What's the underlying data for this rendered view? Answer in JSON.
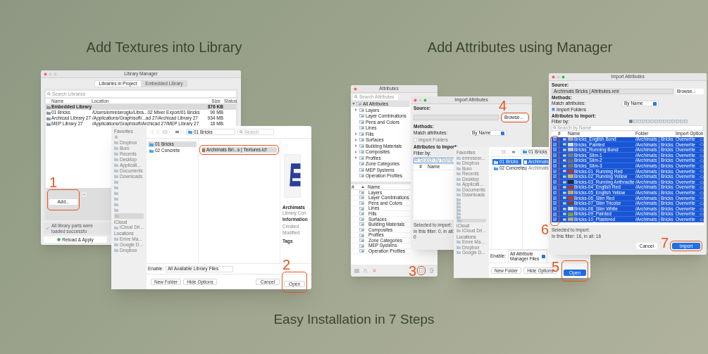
{
  "headings": {
    "left": "Add Textures into Library",
    "right": "Add Attributes using Manager",
    "footer": "Easy Installation in 7 Steps"
  },
  "library_manager": {
    "title": "Library Manager",
    "tabs": [
      {
        "label": "Libraries in Project",
        "selected": true
      },
      {
        "label": "Embedded Library",
        "selected": false
      }
    ],
    "search_placeholder": "Search Libraries",
    "columns": [
      "Name",
      "Location",
      "Size",
      "Status"
    ],
    "rows": [
      {
        "name": "Embedded Library",
        "location": "",
        "size": "876 KB",
        "selected": true
      },
      {
        "name": "01 Bricks",
        "location": "/Users/emreseroglu/Libra...02 Mixer Export/01 Bricks",
        "size": "90 MB",
        "selected": false
      },
      {
        "name": "Archicad Library 27",
        "location": "/Applications/Graphisoft/...ad 27/Archicad Library 27",
        "size": "934 MB",
        "selected": false
      },
      {
        "name": "MEP Library 27",
        "location": "/Applications/Graphisoft/Archicad 27/MEP Library 27",
        "size": "16 MB",
        "selected": false
      }
    ],
    "add_button": "Add...",
    "status_message": "All library parts were loaded successfu",
    "reload_button": "Reload & Apply"
  },
  "open_dialog_textures": {
    "sidebar": [
      {
        "kind": "header",
        "label": "Favorites"
      },
      {
        "kind": "home"
      },
      {
        "kind": "item",
        "label": "Dropbox"
      },
      {
        "kind": "item",
        "label": "Buro"
      },
      {
        "kind": "item",
        "label": "Recents"
      },
      {
        "kind": "item",
        "label": "Desktop"
      },
      {
        "kind": "item",
        "label": "Applicati..."
      },
      {
        "kind": "item",
        "label": "Documents"
      },
      {
        "kind": "item",
        "label": "Downloads"
      },
      {
        "kind": "folder"
      },
      {
        "kind": "folder"
      },
      {
        "kind": "folder"
      },
      {
        "kind": "folder"
      },
      {
        "kind": "folder"
      },
      {
        "kind": "folder"
      },
      {
        "kind": "selected"
      },
      {
        "kind": "header",
        "label": "iCloud"
      },
      {
        "kind": "item",
        "label": "iCloud Dri..."
      },
      {
        "kind": "header",
        "label": "Locations"
      },
      {
        "kind": "item",
        "label": "Emre Ma..."
      },
      {
        "kind": "item",
        "label": "Google D..."
      },
      {
        "kind": "item",
        "label": "Dropbox"
      }
    ],
    "path": "01 Bricks",
    "search_placeholder": "Search",
    "folders": [
      {
        "label": "01 Bricks",
        "selected": true
      },
      {
        "label": "02 Concrete",
        "selected": false
      }
    ],
    "files": [
      {
        "label": "Archimats Bri...s | Textures.lcf",
        "selected": true
      }
    ],
    "preview": {
      "title": "Archimats",
      "subtitle": "Library Con",
      "info": "Information",
      "fields": [
        "Created",
        "Modified"
      ],
      "tags": "Tags"
    },
    "enable_label": "Enable:",
    "enable_value": "All Available Library Files",
    "buttons": [
      {
        "label": "New Folder",
        "kind": "plain"
      },
      {
        "label": "Hide Options",
        "kind": "plain"
      },
      {
        "label": "Cancel",
        "kind": "right"
      },
      {
        "label": "Open",
        "kind": "right"
      }
    ]
  },
  "attributes_panel": {
    "title": "Attributes",
    "search_placeholder": "Search Attributes",
    "root": "All Attributes",
    "tree": [
      {
        "label": "Layers",
        "expandable": true
      },
      {
        "label": "Layer Combinations",
        "expandable": false
      },
      {
        "label": "Pens and Colors",
        "expandable": false
      },
      {
        "label": "Lines",
        "expandable": false
      },
      {
        "label": "Fills",
        "expandable": true
      },
      {
        "label": "Surfaces",
        "expandable": true
      },
      {
        "label": "Building Materials",
        "expandable": true
      },
      {
        "label": "Composites",
        "expandable": true
      },
      {
        "label": "Profiles",
        "expandable": true
      },
      {
        "label": "Zone Categories",
        "expandable": false
      },
      {
        "label": "MEP Systems",
        "expandable": false
      },
      {
        "label": "Operation Profiles",
        "expandable": false
      }
    ],
    "list_columns": [
      "#",
      "Name"
    ],
    "list": [
      "Layers",
      "Layer Combinations",
      "Pens and Colors",
      "Lines",
      "Fills",
      "Surfaces",
      "Building Materials",
      "Composites",
      "Profiles",
      "Zone Categories",
      "MEP Systems",
      "Operation Profiles"
    ]
  },
  "import_empty": {
    "title": "Import Attributes",
    "source_label": "Source:",
    "browse": "Browse...",
    "methods_label": "Methods:",
    "match_label": "Match attributes:",
    "match_value": "By Name",
    "import_folders": {
      "label": "Import Folders",
      "checked": false
    },
    "attributes_label": "Attributes to Import:",
    "filter_label": "Filter by:",
    "search_placeholder": "Search by Name",
    "columns": [
      "#",
      "Name"
    ],
    "selected_label": "Selected to import:",
    "count": "In this filter: 0, in all: 0"
  },
  "open_dialog_attributes": {
    "sidebar": [
      {
        "kind": "header",
        "label": "Favorites"
      },
      {
        "kind": "item",
        "label": "emreseer..."
      },
      {
        "kind": "item",
        "label": "Dropbox"
      },
      {
        "kind": "item",
        "label": "Buro"
      },
      {
        "kind": "item",
        "label": "Recents"
      },
      {
        "kind": "item",
        "label": "Desktop"
      },
      {
        "kind": "item",
        "label": "Applicati..."
      },
      {
        "kind": "item",
        "label": "Documents"
      },
      {
        "kind": "item",
        "label": "Downloads"
      },
      {
        "kind": "folder"
      },
      {
        "kind": "folder"
      },
      {
        "kind": "folder"
      },
      {
        "kind": "folder"
      },
      {
        "kind": "folder"
      },
      {
        "kind": "folder"
      },
      {
        "kind": "selected"
      },
      {
        "kind": "header",
        "label": "iCloud"
      },
      {
        "kind": "item",
        "label": "iCloud Dri..."
      },
      {
        "kind": "header",
        "label": "Locations"
      },
      {
        "kind": "item",
        "label": "Emre Ma..."
      },
      {
        "kind": "item",
        "label": "Dropbox"
      },
      {
        "kind": "item",
        "label": "Google D..."
      }
    ],
    "path": "01 Bricks",
    "folders": [
      {
        "label": "01 Bricks",
        "selected": true
      },
      {
        "label": "02 Concrete",
        "selected": false
      }
    ],
    "files": [
      {
        "label": "Archimats",
        "selected": true
      },
      {
        "label": "Archimats",
        "selected": false
      }
    ],
    "enable_label": "Enable:",
    "enable_value": "All Attribute Manager Files",
    "buttons": [
      {
        "label": "New Folder",
        "kind": "plain"
      },
      {
        "label": "Hide Options",
        "kind": "plain"
      },
      {
        "label": "Open",
        "kind": "default"
      }
    ]
  },
  "import_filled": {
    "title": "Import Attributes",
    "source_label": "Source:",
    "source_value": "Archimats Bricks | Attributes.xml",
    "browse": "Browse...",
    "methods_label": "Methods:",
    "match_label": "Match attributes:",
    "match_value": "By Name",
    "import_folders": {
      "label": "Import Folders",
      "checked": true
    },
    "attributes_label": "Attributes to Import:",
    "filter_label": "Filter by:",
    "search_placeholder": "Search by Name",
    "columns": [
      "#",
      "Name",
      "Folder",
      "Import Option"
    ],
    "rows": [
      {
        "name": "Bricks_English Bond",
        "folder": "/Archimats | Bricks",
        "option": "Overwrite",
        "color": "#a9a9a9",
        "checked": true
      },
      {
        "name": "Bricks_Painted",
        "folder": "/Archimats | Bricks",
        "option": "Overwrite",
        "color": "#d9d9d6",
        "checked": true
      },
      {
        "name": "Bricks_Running Bond",
        "folder": "/Archimats | Bricks",
        "option": "Overwrite",
        "color": "#c4c4c0",
        "checked": true
      },
      {
        "name": "Bricks_Slim-1",
        "folder": "/Archimats | Bricks",
        "option": "Overwrite",
        "color": "#7c7c7c",
        "checked": true
      },
      {
        "name": "Bricks_Slim-2",
        "folder": "/Archimats | Bricks",
        "option": "Overwrite",
        "color": "#6f6f6f",
        "checked": true
      },
      {
        "name": "Bricks_Slim-3",
        "folder": "/Archimats | Bricks",
        "option": "Overwrite",
        "color": "#737373",
        "checked": true
      },
      {
        "name": "Bricks-01_Running Red",
        "folder": "/Archimats | Bricks",
        "option": "Overwrite",
        "color": "#b53a2f",
        "checked": true
      },
      {
        "name": "Bricks-02_Running Yellow",
        "folder": "/Archimats | Bricks",
        "option": "Overwrite",
        "color": "#c9b06a",
        "checked": true
      },
      {
        "name": "Bricks-03_Running Anthracite",
        "folder": "/Archimats | Bricks",
        "option": "Overwrite",
        "color": "#2a2a2e",
        "checked": true
      },
      {
        "name": "Bricks-04_English Red",
        "folder": "/Archimats | Bricks",
        "option": "Overwrite",
        "color": "#a8392e",
        "checked": true
      },
      {
        "name": "Bricks-05_English Yellow",
        "folder": "/Archimats | Bricks",
        "option": "Overwrite",
        "color": "#caa860",
        "checked": true
      },
      {
        "name": "Bricks-06_Slim Red",
        "folder": "/Archimats | Bricks",
        "option": "Overwrite",
        "color": "#b0413a",
        "checked": true
      },
      {
        "name": "Bricks-07_Slim Tricolor",
        "folder": "/Archimats | Bricks",
        "option": "Overwrite",
        "color": "#8a3a30",
        "checked": true
      },
      {
        "name": "Bricks-08_Slim White",
        "folder": "/Archimats | Bricks",
        "option": "Overwrite",
        "color": "#dcdcd8",
        "checked": true
      },
      {
        "name": "Bricks-09_Painted",
        "folder": "/Archimats | Bricks",
        "option": "Overwrite",
        "color": "#7a9a5a",
        "checked": true
      },
      {
        "name": "Bricks-10_Plastered",
        "folder": "/Archimats | Bricks",
        "option": "Overwrite",
        "color": "#b8a878",
        "checked": true
      }
    ],
    "selected_label": "Selected to import:",
    "count": "In this filter: 16, in all: 16",
    "buttons": [
      {
        "label": "Cancel",
        "kind": "plain"
      },
      {
        "label": "Import",
        "kind": "default"
      }
    ]
  },
  "steps": [
    "1",
    "2",
    "3",
    "4",
    "5",
    "6",
    "7"
  ]
}
